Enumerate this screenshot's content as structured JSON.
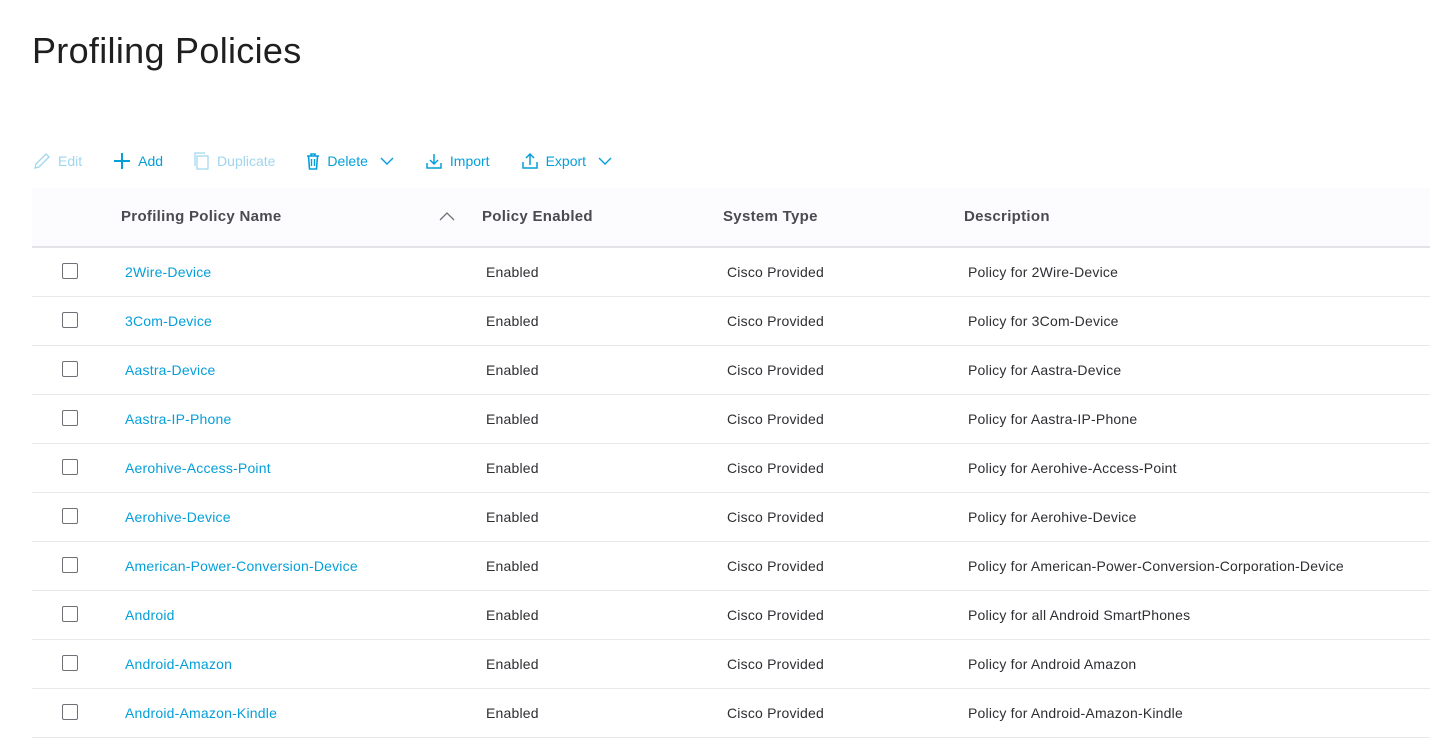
{
  "page": {
    "title": "Profiling Policies"
  },
  "toolbar": {
    "edit": "Edit",
    "add": "Add",
    "duplicate": "Duplicate",
    "delete": "Delete",
    "import": "Import",
    "export": "Export"
  },
  "table": {
    "headers": {
      "name": "Profiling Policy Name",
      "enabled": "Policy Enabled",
      "system_type": "System Type",
      "description": "Description"
    },
    "sort": {
      "column": "name",
      "direction": "ascending"
    },
    "rows": [
      {
        "name": "2Wire-Device",
        "enabled": "Enabled",
        "system_type": "Cisco Provided",
        "description": "Policy for 2Wire-Device"
      },
      {
        "name": "3Com-Device",
        "enabled": "Enabled",
        "system_type": "Cisco Provided",
        "description": "Policy for 3Com-Device"
      },
      {
        "name": "Aastra-Device",
        "enabled": "Enabled",
        "system_type": "Cisco Provided",
        "description": "Policy for Aastra-Device"
      },
      {
        "name": "Aastra-IP-Phone",
        "enabled": "Enabled",
        "system_type": "Cisco Provided",
        "description": "Policy for Aastra-IP-Phone"
      },
      {
        "name": "Aerohive-Access-Point",
        "enabled": "Enabled",
        "system_type": "Cisco Provided",
        "description": "Policy for Aerohive-Access-Point"
      },
      {
        "name": "Aerohive-Device",
        "enabled": "Enabled",
        "system_type": "Cisco Provided",
        "description": "Policy for Aerohive-Device"
      },
      {
        "name": "American-Power-Conversion-Device",
        "enabled": "Enabled",
        "system_type": "Cisco Provided",
        "description": "Policy for American-Power-Conversion-Corporation-Device"
      },
      {
        "name": "Android",
        "enabled": "Enabled",
        "system_type": "Cisco Provided",
        "description": "Policy for all Android SmartPhones"
      },
      {
        "name": "Android-Amazon",
        "enabled": "Enabled",
        "system_type": "Cisco Provided",
        "description": "Policy for Android Amazon"
      },
      {
        "name": "Android-Amazon-Kindle",
        "enabled": "Enabled",
        "system_type": "Cisco Provided",
        "description": "Policy for Android-Amazon-Kindle"
      }
    ]
  },
  "colors": {
    "accent": "#049fd9",
    "accent_disabled": "#9fd6ee",
    "header_bg": "#fcfbfe"
  }
}
